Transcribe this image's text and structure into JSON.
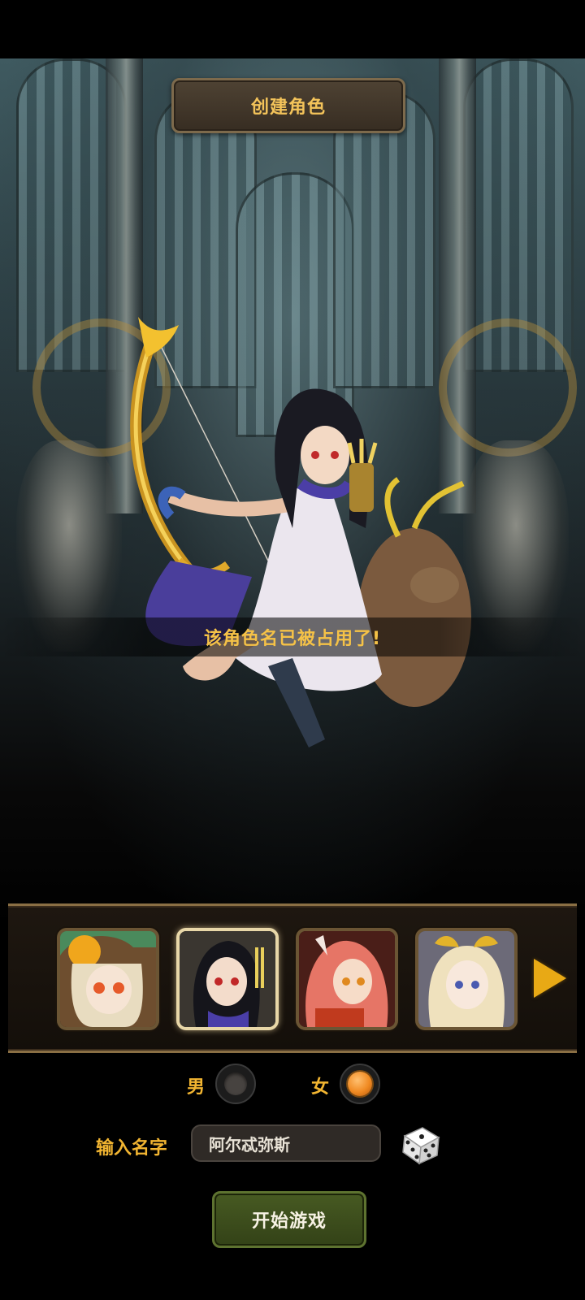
{
  "header": {
    "title": "创建角色"
  },
  "toast": {
    "message": "该角色名已被占用了!"
  },
  "roster": {
    "portraits": [
      {
        "name": "portrait-1",
        "selected": false
      },
      {
        "name": "portrait-2",
        "selected": true
      },
      {
        "name": "portrait-3",
        "selected": false
      },
      {
        "name": "portrait-4",
        "selected": false
      }
    ],
    "next_icon": "arrow-right-icon"
  },
  "gender": {
    "male_label": "男",
    "female_label": "女",
    "selected": "female"
  },
  "name_entry": {
    "label": "输入名字",
    "value": "阿尔忒弥斯",
    "random_icon": "dice-icon"
  },
  "start_button": {
    "label": "开始游戏"
  },
  "colors": {
    "accent_gold": "#f2b531",
    "button_green": "#3d4d1c",
    "selected_radio": "#f08a22"
  }
}
